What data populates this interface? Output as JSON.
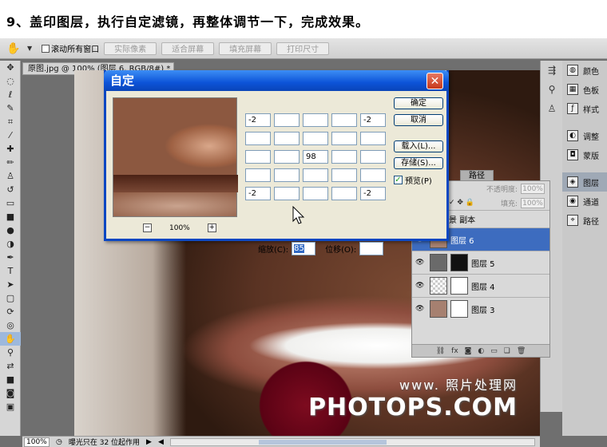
{
  "caption": "9、盖印图层，执行自定滤镜，再整体调节一下，完成效果。",
  "options_bar": {
    "scroll_all_windows": "滚动所有窗口",
    "buttons": [
      "实际像素",
      "适合屏幕",
      "填充屏幕",
      "打印尺寸"
    ]
  },
  "document": {
    "tab_label": "原图.jpg @ 100% (图层 6, RGB/8#) *"
  },
  "dialog": {
    "title": "自定",
    "zoom_percent": "100%",
    "grid_values": [
      "-2",
      "",
      "",
      "",
      "-2",
      "",
      "",
      "",
      "",
      "",
      "",
      "",
      "98",
      "",
      "",
      "",
      "",
      "",
      "",
      "",
      "-2",
      "",
      "",
      "",
      "-2"
    ],
    "scale_label": "缩放(C):",
    "scale_value": "85",
    "offset_label": "位移(O):",
    "offset_value": "",
    "ok": "确定",
    "cancel": "取消",
    "load": "载入(L)...",
    "save": "存储(S)...",
    "preview": "预览(P)"
  },
  "panels": {
    "items": [
      "颜色",
      "色板",
      "样式",
      "调整",
      "蒙版",
      "图层",
      "通道",
      "路径"
    ]
  },
  "layers_panel": {
    "tab_label": "路径",
    "opacity_label": "不透明度:",
    "opacity": "100%",
    "fill_label": "填充:",
    "fill": "100%",
    "layers": [
      {
        "name": "背景 副本"
      },
      {
        "name": "图层 6"
      },
      {
        "name": "图层 5"
      },
      {
        "name": "图层 4"
      },
      {
        "name": "图层 3"
      }
    ]
  },
  "status_bar": {
    "zoom": "100%",
    "message": "曝光只在 32 位起作用"
  },
  "watermark": {
    "line1": "www.   照片处理网",
    "line2": "PHOTOPS.COM"
  }
}
